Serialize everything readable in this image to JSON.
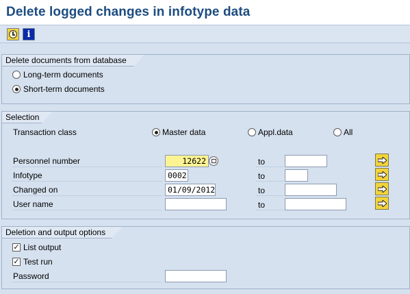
{
  "window": {
    "title": "Delete logged changes in infotype data"
  },
  "toolbar": {
    "execute_icon": "execute-clock-icon",
    "info_icon": "information-icon",
    "info_glyph": "i"
  },
  "group_documents": {
    "title": "Delete documents from database",
    "options": [
      {
        "label": "Long-term documents",
        "selected": false
      },
      {
        "label": "Short-term documents",
        "selected": true
      }
    ]
  },
  "group_selection": {
    "title": "Selection",
    "transaction_class": {
      "label": "Transaction class",
      "options": [
        {
          "label": "Master data",
          "selected": true
        },
        {
          "label": "Appl.data",
          "selected": false
        },
        {
          "label": "All",
          "selected": false
        }
      ]
    },
    "rows": [
      {
        "label": "Personnel number",
        "from": "12622",
        "to_label": "to",
        "to": ""
      },
      {
        "label": "Infotype",
        "from": "0002",
        "to_label": "to",
        "to": ""
      },
      {
        "label": "Changed on",
        "from": "01/09/2012",
        "to_label": "to",
        "to": ""
      },
      {
        "label": "User name",
        "from": "",
        "to_label": "to",
        "to": ""
      }
    ],
    "multiple_selection_icon": "arrow-right-icon"
  },
  "group_output": {
    "title": "Deletion and output options",
    "list_output": {
      "label": "List output",
      "checked": true
    },
    "test_run": {
      "label": "Test run",
      "checked": true
    },
    "password": {
      "label": "Password",
      "value": ""
    }
  },
  "colors": {
    "title": "#1c4c80",
    "background": "#d6e1ef",
    "required_field": "#fcf393",
    "button_yellow": "#f2d33a"
  }
}
